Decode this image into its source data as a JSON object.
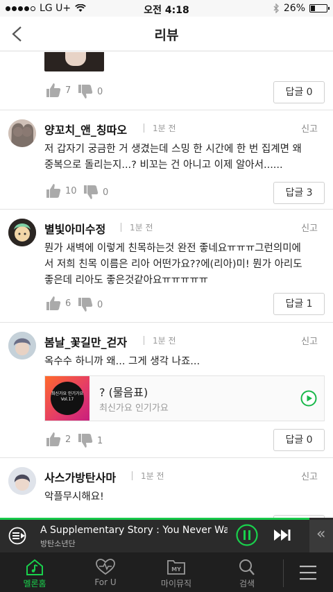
{
  "status_bar": {
    "carrier": "LG U+",
    "time": "오전 4:18",
    "battery": "26%",
    "battery_level": 0.26
  },
  "header": {
    "title": "리뷰"
  },
  "top_stub": {
    "likes": "7",
    "dislikes": "0",
    "reply_label": "답글 0"
  },
  "comments": [
    {
      "username": "양꼬치_앤_칭따오",
      "time": "1분 전",
      "report": "신고",
      "line1": "저 갑자기 궁금한 거 생겼는데 스밍 한 시간에 한 번 집계면 왜",
      "line2": "중복으로 돌리는지...? 비꼬는 건 아니고 이제 알아서......",
      "likes": "10",
      "dislikes": "0",
      "reply_label": "답글 3"
    },
    {
      "username": "별빛아미수정",
      "time": "1분 전",
      "report": "신고",
      "line1": "뭔가 새벽에 이렇게 친목하는것 완전 좋네요ㅠㅠㅠ그런의미에",
      "line2": "서 저희 친목 이름은 리아 어떤가요??에(리아)미! 뭔가 아리도",
      "line3": "좋은데 리아도 좋은것같아요ㅠㅠㅠㅠㅠ",
      "likes": "6",
      "dislikes": "0",
      "reply_label": "답글 1"
    },
    {
      "username": "봄날_꽃길만_걷자",
      "time": "1분 전",
      "report": "신고",
      "line1": "옥수수 하니까 왜... 그게 생각 나죠...",
      "song": {
        "title": "? (물음표)",
        "subtitle": "최신가요 인기가요",
        "album_text": "최신가요 인기가요 Vol.17"
      },
      "likes": "2",
      "dislikes": "1",
      "reply_label": "답글 0"
    },
    {
      "username": "사스가방탄사마",
      "time": "1분 전",
      "report": "신고",
      "line1": "악플무시해요!"
    }
  ],
  "player": {
    "title": "A Supplementary Story : You Never Wal…",
    "artist": "방탄소년단",
    "progress": 0.93
  },
  "tabs": [
    {
      "label": "멜론홈",
      "icon": "home-icon"
    },
    {
      "label": "For U",
      "icon": "heart-music-icon"
    },
    {
      "label": "마이뮤직",
      "icon": "my-music-icon"
    },
    {
      "label": "검색",
      "icon": "search-icon"
    },
    {
      "label": "",
      "icon": "menu-icon"
    }
  ],
  "colors": {
    "accent": "#19d14c",
    "player_bg": "#2b2b2b",
    "tabbar_bg": "#1f1f1f"
  }
}
